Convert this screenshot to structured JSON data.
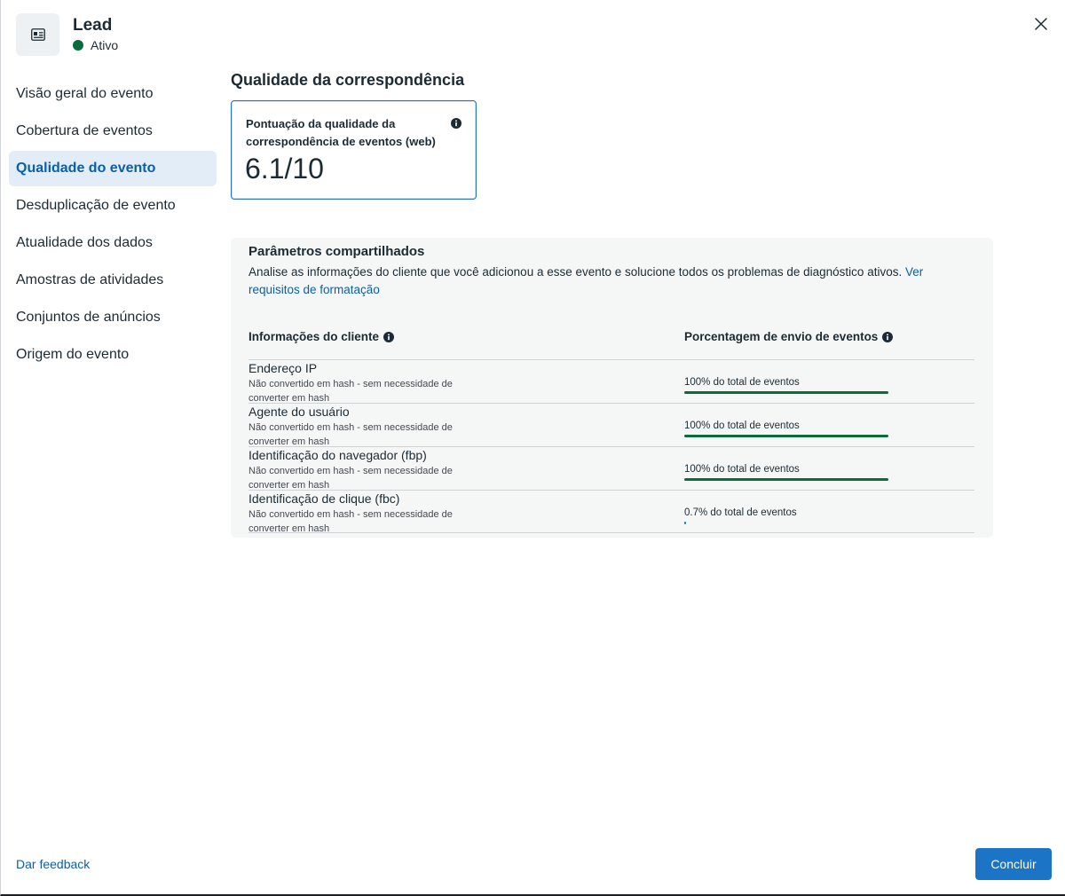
{
  "header": {
    "icon": "contact-card-icon",
    "title": "Lead",
    "status": "Ativo",
    "status_color": "#0b6b3a",
    "close_icon": "close-icon"
  },
  "sidebar": {
    "items": [
      {
        "label": "Visão geral do evento",
        "active": false
      },
      {
        "label": "Cobertura de eventos",
        "active": false
      },
      {
        "label": "Qualidade do evento",
        "active": true
      },
      {
        "label": "Desduplicação de evento",
        "active": false
      },
      {
        "label": "Atualidade dos dados",
        "active": false
      },
      {
        "label": "Amostras de atividades",
        "active": false
      },
      {
        "label": "Conjuntos de anúncios",
        "active": false
      },
      {
        "label": "Origem do evento",
        "active": false
      }
    ]
  },
  "main": {
    "section_title": "Qualidade da correspondência",
    "score_card": {
      "label": "Pontuação da qualidade da correspondência de eventos (web)",
      "value": "6.1/10",
      "info_icon": "info-icon"
    },
    "params": {
      "title": "Parâmetros compartilhados",
      "description": "Analise as informações do cliente que você adicionou a esse evento e solucione todos os problemas de diagnóstico ativos. ",
      "link": "Ver requisitos de formatação",
      "col_left": "Informações do cliente",
      "col_right": "Porcentagem de envio de eventos",
      "rows": [
        {
          "name": "Endereço IP",
          "note": "Não convertido em hash - sem necessidade de converter em hash",
          "pct_label": "100% do total de eventos",
          "fraction": 1.0
        },
        {
          "name": "Agente do usuário",
          "note": "Não convertido em hash - sem necessidade de converter em hash",
          "pct_label": "100% do total de eventos",
          "fraction": 1.0
        },
        {
          "name": "Identificação do navegador (fbp)",
          "note": "Não convertido em hash - sem necessidade de converter em hash",
          "pct_label": "100% do total de eventos",
          "fraction": 1.0
        },
        {
          "name": "Identificação de clique (fbc)",
          "note": "Não convertido em hash - sem necessidade de converter em hash",
          "pct_label": "0.7% do total de eventos",
          "fraction": 0.007
        }
      ]
    }
  },
  "footer": {
    "feedback": "Dar feedback",
    "done": "Concluir"
  },
  "colors": {
    "accent": "#1b74c5",
    "link": "#0a5fad",
    "success": "#0b6b3a"
  }
}
